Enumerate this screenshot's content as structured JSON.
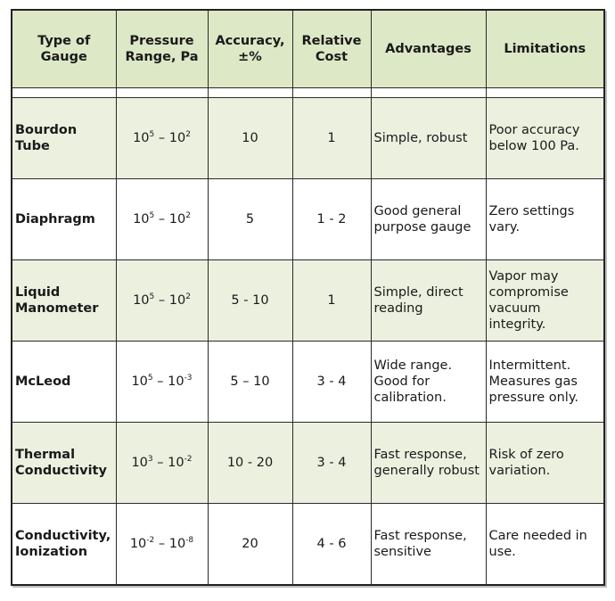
{
  "table": {
    "headers": [
      {
        "line1": "Type of",
        "line2": "Gauge"
      },
      {
        "line1": "Pressure",
        "line2": "Range, Pa"
      },
      {
        "line1": "Accuracy,",
        "line2": "±%"
      },
      {
        "line1": "Relative",
        "line2": "Cost"
      },
      {
        "line1": "Advantages",
        "line2": ""
      },
      {
        "line1": "Limitations",
        "line2": ""
      }
    ],
    "rows": [
      {
        "type": "Bourdon Tube",
        "range": {
          "hi_base": "10",
          "hi_exp": "5",
          "sep": " – ",
          "lo_base": "10",
          "lo_exp": "2"
        },
        "accuracy": "10",
        "cost": "1",
        "advantages": "Simple, robust",
        "limitations": "Poor accuracy below 100 Pa."
      },
      {
        "type": "Diaphragm",
        "range": {
          "hi_base": "10",
          "hi_exp": "5",
          "sep": " – ",
          "lo_base": "10",
          "lo_exp": "2"
        },
        "accuracy": "5",
        "cost": "1 - 2",
        "advantages": "Good general purpose gauge",
        "limitations": "Zero settings vary."
      },
      {
        "type": "Liquid Manometer",
        "range": {
          "hi_base": "10",
          "hi_exp": "5",
          "sep": " – ",
          "lo_base": "10",
          "lo_exp": "2"
        },
        "accuracy": "5 - 10",
        "cost": "1",
        "advantages": "Simple, direct reading",
        "limitations": "Vapor may compromise vacuum integrity."
      },
      {
        "type": "McLeod",
        "range": {
          "hi_base": "10",
          "hi_exp": "5",
          "sep": " – ",
          "lo_base": "10",
          "lo_exp": "-3"
        },
        "accuracy": "5 – 10",
        "cost": "3 - 4",
        "advantages": "Wide range. Good for calibration.",
        "limitations": "Intermittent. Measures gas pressure only."
      },
      {
        "type": "Thermal Conductivity",
        "range": {
          "hi_base": "10",
          "hi_exp": "3",
          "sep": " – ",
          "lo_base": "10",
          "lo_exp": "-2"
        },
        "accuracy": "10 - 20",
        "cost": "3 - 4",
        "advantages": "Fast response, generally robust",
        "limitations": "Risk of zero variation."
      },
      {
        "type": "Conductivity, Ionization",
        "range": {
          "hi_base": "10",
          "hi_exp": "-2",
          "sep": " – ",
          "lo_base": "10",
          "lo_exp": "-8"
        },
        "accuracy": "20",
        "cost": "4 - 6",
        "advantages": "Fast response, sensitive",
        "limitations": "Care needed in use."
      }
    ]
  }
}
